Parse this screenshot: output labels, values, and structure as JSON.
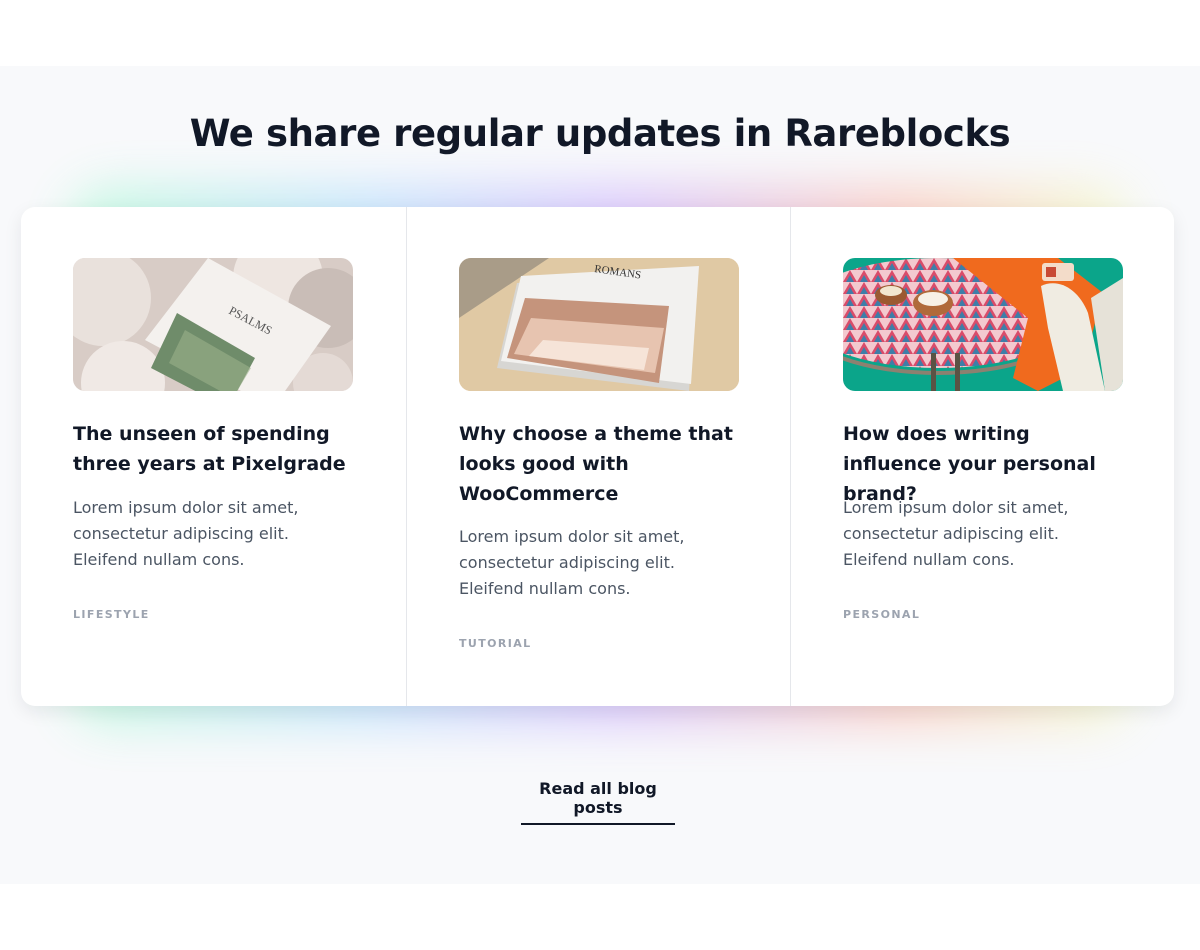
{
  "section": {
    "heading": "We share regular updates in Rareblocks",
    "read_more_label": "Read all blog posts"
  },
  "posts": [
    {
      "title": "The unseen of spending three years at Pixelgrade",
      "excerpt": "Lorem ipsum dolor sit amet, consectetur adipiscing elit. Eleifend nullam cons.",
      "category": "LIFESTYLE",
      "image_label": "PSALMS"
    },
    {
      "title": "Why choose a theme that looks good with WooCommerce",
      "excerpt": "Lorem ipsum dolor sit amet, consectetur adipiscing elit. Eleifend nullam cons.",
      "category": "TUTORIAL",
      "image_label": "ROMANS"
    },
    {
      "title": "How does writing influence your personal brand?",
      "excerpt": "Lorem ipsum dolor sit amet, consectetur adipiscing elit. Eleifend nullam cons.",
      "category": "PERSONAL"
    }
  ],
  "colors": {
    "heading": "#111827",
    "body_text": "#4b5563",
    "category": "#9ca3af",
    "section_bg": "#f8f9fb",
    "card_bg": "#ffffff"
  }
}
